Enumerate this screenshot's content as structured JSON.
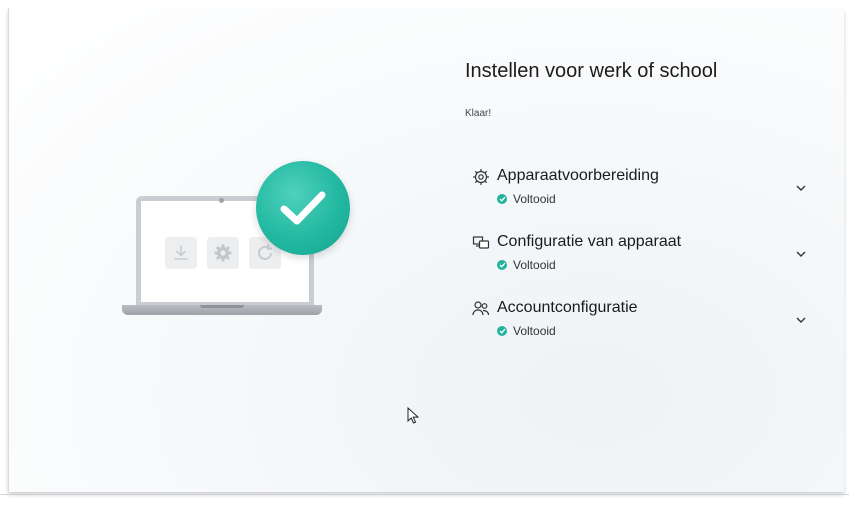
{
  "title": "Instellen voor werk of school",
  "status": "Klaar!",
  "accent_color": "#23b29c",
  "illustration": {
    "main_icon": "check-circle-icon",
    "tiles": [
      "download-icon",
      "gear-icon",
      "refresh-icon"
    ]
  },
  "sections": [
    {
      "icon": "gear-icon",
      "title": "Apparaatvoorbereiding",
      "status": "Voltooid"
    },
    {
      "icon": "devices-icon",
      "title": "Configuratie van apparaat",
      "status": "Voltooid"
    },
    {
      "icon": "people-icon",
      "title": "Accountconfiguratie",
      "status": "Voltooid"
    }
  ]
}
